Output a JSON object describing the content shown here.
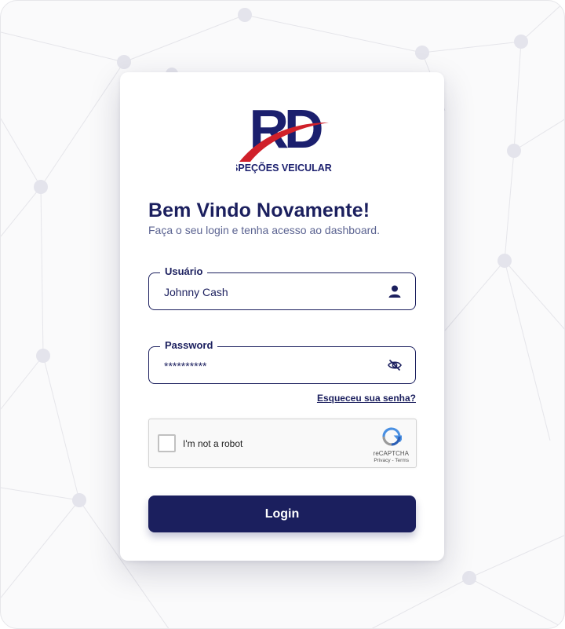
{
  "brand": {
    "logo_text": "RD",
    "logo_subtitle": "INSPEÇÕES VEICULARES",
    "primary_color": "#1b1f5e",
    "accent_color": "#d0202a"
  },
  "header": {
    "title": "Bem Vindo Novamente!",
    "subtitle": "Faça o seu login e tenha acesso ao dashboard."
  },
  "form": {
    "username": {
      "label": "Usuário",
      "value": "Johnny Cash",
      "icon": "user-icon"
    },
    "password": {
      "label": "Password",
      "value": "**********",
      "icon": "eye-off-icon"
    },
    "forgot_link": "Esqueceu sua senha?",
    "recaptcha": {
      "checkbox_label": "I'm not a robot",
      "brand": "reCAPTCHA",
      "links": "Privacy - Terms"
    },
    "submit_label": "Login"
  }
}
